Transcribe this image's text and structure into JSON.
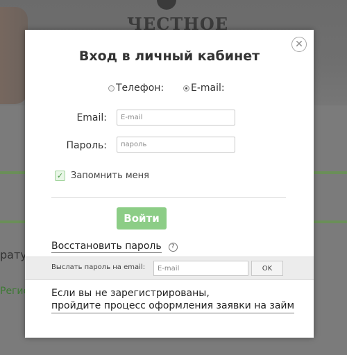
{
  "background": {
    "logo_text": "ЧЕСТНОЕ",
    "left_text": "рату",
    "left_link": "Регис"
  },
  "modal": {
    "title": "Вход в личный кабинет",
    "close_symbol": "✕",
    "radio_options": [
      {
        "label": "Телефон:",
        "checked": false
      },
      {
        "label": "E-mail:",
        "checked": true
      }
    ],
    "email": {
      "label": "Email:",
      "placeholder": "E-mail"
    },
    "password": {
      "label": "Пароль:",
      "placeholder": "пароль"
    },
    "remember": {
      "label": "Запомнить меня",
      "checked": true,
      "mark": "✓"
    },
    "login_button": "Войти",
    "restore": {
      "link": "Восстановить пароль",
      "help_symbol": "?",
      "send_label": "Выслать пароль на email:",
      "email_placeholder": "E-mail",
      "ok_button": "OK"
    },
    "register": {
      "line1": "Если вы не зарегистрированы,",
      "line2": "пройдите процесс оформления заявки на займ"
    }
  },
  "colors": {
    "overlay": "#7b7b7b",
    "login_button": "#8ccd86",
    "checkbox_accent": "#4c9a48",
    "background_green_line": "#6a8f58"
  }
}
